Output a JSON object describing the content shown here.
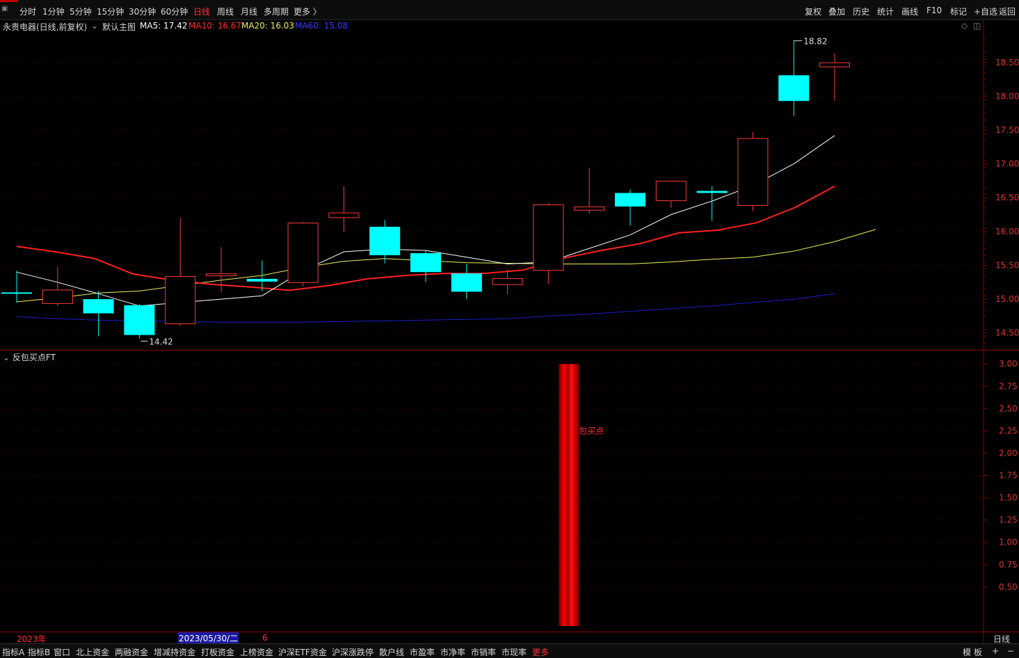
{
  "toolbar": {
    "periods": [
      "分时",
      "1分钟",
      "5分钟",
      "15分钟",
      "30分钟",
      "60分钟",
      "日线",
      "周线",
      "月线",
      "多周期",
      "更多 〉"
    ],
    "active_period": "日线",
    "tools": [
      "复权",
      "叠加",
      "历史",
      "统计",
      "画线",
      "F10",
      "标记",
      "+自选",
      "返回"
    ]
  },
  "info": {
    "stock": "永贵电器(日线,前复权)",
    "template": "默认主图",
    "ma5": "MA5: 17.42",
    "ma10": "MA10: 16.67",
    "ma20": "MA20: 16.03",
    "ma60": "MA60: 15.08"
  },
  "subchart": {
    "title": "反包买点FT",
    "annotation": "包买点"
  },
  "datebar": {
    "year": "2023年",
    "cursor_date": "2023/05/30/二",
    "tick": "6"
  },
  "bottom": {
    "tabs": [
      "指标A",
      "指标B",
      "窗口",
      "北上资金",
      "两融资金",
      "增减持资金",
      "打板资金",
      "上榜资金",
      "沪深ETF资金",
      "沪深涨跌停",
      "散户线",
      "市盈率",
      "市净率",
      "市销率",
      "市现率",
      "更多"
    ],
    "right": [
      "模",
      "板",
      "+",
      "−"
    ],
    "period_label": "日线"
  },
  "colors": {
    "up": "#ff3c3c",
    "down": "#00ffff",
    "ma5": "#ffffff",
    "ma10": "#ff2020",
    "ma20": "#f0f060",
    "ma60": "#1c1ccc",
    "axis": "#8b0000"
  },
  "chart_data": [
    {
      "type": "candlestick",
      "title": "永贵电器(日线,前复权)",
      "ylim": [
        14.25,
        18.95
      ],
      "yticks": [
        14.5,
        15.0,
        15.5,
        16.0,
        16.5,
        17.0,
        17.5,
        18.0,
        18.5
      ],
      "ytick_labels": [
        "14.50",
        "15.00",
        "15.50",
        "16.00",
        "16.50",
        "17.00",
        "17.50",
        "18.00",
        "18.50"
      ],
      "candles": [
        {
          "o": 15.1,
          "c": 15.08,
          "h": 15.42,
          "l": 14.95
        },
        {
          "o": 14.93,
          "c": 15.14,
          "h": 15.48,
          "l": 14.9
        },
        {
          "o": 15.0,
          "c": 14.79,
          "h": 15.12,
          "l": 14.45
        },
        {
          "o": 14.91,
          "c": 14.47,
          "h": 14.93,
          "l": 14.42
        },
        {
          "o": 14.63,
          "c": 15.34,
          "h": 16.2,
          "l": 14.61
        },
        {
          "o": 15.34,
          "c": 15.38,
          "h": 15.77,
          "l": 15.1
        },
        {
          "o": 15.3,
          "c": 15.26,
          "h": 15.57,
          "l": 15.12
        },
        {
          "o": 15.24,
          "c": 16.13,
          "h": 16.14,
          "l": 15.19
        },
        {
          "o": 16.2,
          "c": 16.28,
          "h": 16.67,
          "l": 15.99
        },
        {
          "o": 16.07,
          "c": 15.65,
          "h": 16.17,
          "l": 15.53
        },
        {
          "o": 15.68,
          "c": 15.4,
          "h": 15.73,
          "l": 15.25
        },
        {
          "o": 15.38,
          "c": 15.11,
          "h": 15.52,
          "l": 15.0
        },
        {
          "o": 15.21,
          "c": 15.31,
          "h": 15.43,
          "l": 15.07
        },
        {
          "o": 15.42,
          "c": 16.4,
          "h": 16.42,
          "l": 15.23
        },
        {
          "o": 16.31,
          "c": 16.37,
          "h": 16.94,
          "l": 16.26
        },
        {
          "o": 16.57,
          "c": 16.37,
          "h": 16.62,
          "l": 16.09
        },
        {
          "o": 16.45,
          "c": 16.75,
          "h": 16.75,
          "l": 16.35
        },
        {
          "o": 16.6,
          "c": 16.57,
          "h": 16.67,
          "l": 16.16
        },
        {
          "o": 16.38,
          "c": 17.38,
          "h": 17.47,
          "l": 16.3
        },
        {
          "o": 18.31,
          "c": 17.93,
          "h": 18.82,
          "l": 17.71
        },
        {
          "o": 18.43,
          "c": 18.5,
          "h": 18.63,
          "l": 17.93
        }
      ],
      "marks": {
        "high": "18.82",
        "low": "14.42"
      },
      "ma5": [
        15.4,
        15.25,
        15.08,
        14.9,
        14.95,
        15.0,
        15.05,
        15.42,
        15.7,
        15.74,
        15.72,
        15.62,
        15.52,
        15.55,
        15.75,
        15.95,
        16.25,
        16.45,
        16.68,
        17.0,
        17.42
      ],
      "ma10": [
        15.78,
        15.7,
        15.6,
        15.37,
        15.28,
        15.22,
        15.18,
        15.13,
        15.2,
        15.3,
        15.35,
        15.38,
        15.38,
        15.43,
        15.6,
        15.72,
        15.82,
        15.98,
        16.02,
        16.13,
        16.36,
        16.67
      ],
      "ma20": [
        14.96,
        15.02,
        15.09,
        15.12,
        15.2,
        15.28,
        15.35,
        15.47,
        15.56,
        15.6,
        15.57,
        15.54,
        15.53,
        15.52,
        15.52,
        15.52,
        15.55,
        15.59,
        15.62,
        15.71,
        15.85,
        16.03
      ],
      "ma60": [
        14.74,
        14.71,
        14.69,
        14.68,
        14.67,
        14.66,
        14.66,
        14.66,
        14.67,
        14.68,
        14.69,
        14.7,
        14.71,
        14.75,
        14.78,
        14.82,
        14.86,
        14.9,
        14.95,
        15.0,
        15.08
      ]
    },
    {
      "type": "bar",
      "title": "反包买点FT",
      "ylim": [
        0,
        3.15
      ],
      "yticks": [
        0.5,
        0.75,
        1.0,
        1.25,
        1.5,
        1.75,
        2.0,
        2.25,
        2.5,
        2.75,
        3.0
      ],
      "ytick_labels": [
        "0.50",
        "0.75",
        "1.00",
        "1.25",
        "1.50",
        "1.75",
        "2.00",
        "2.25",
        "2.50",
        "2.75",
        "3.00"
      ],
      "bars": [
        {
          "index": 13,
          "value": 3.0
        }
      ]
    }
  ]
}
